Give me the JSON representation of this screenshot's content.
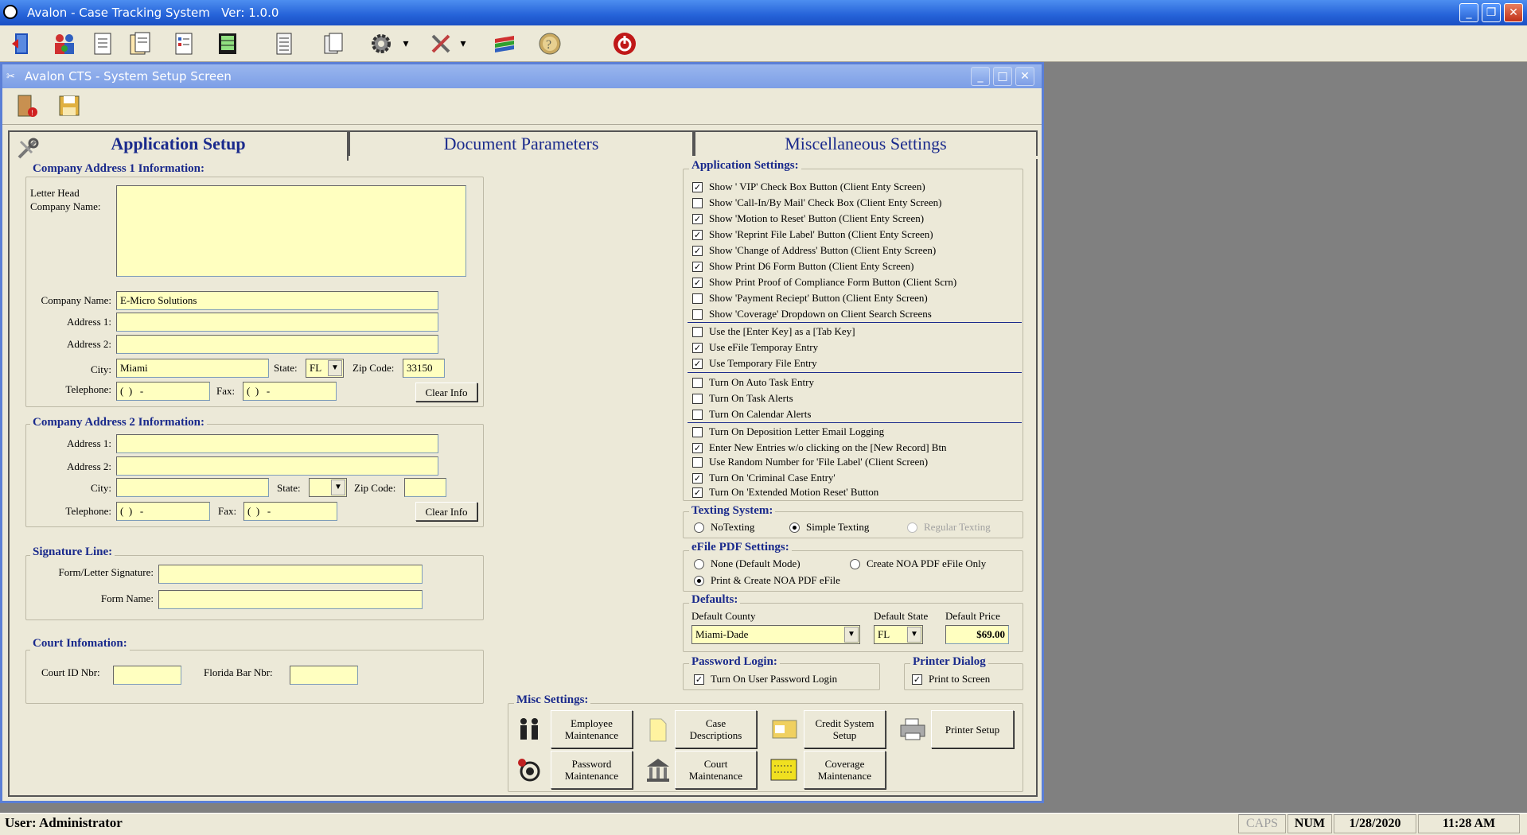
{
  "app": {
    "title": "Avalon - Case Tracking System   Ver: 1.0.0"
  },
  "toolbar_icons": [
    "exit-door-icon",
    "people-icon",
    "document-icon",
    "documents-icon",
    "checklist-icon",
    "ledger-icon",
    "scroll-icon",
    "pages-icon",
    "gear-icon",
    "tools-icon",
    "layers-icon",
    "help-icon",
    "power-icon"
  ],
  "window": {
    "title": "Avalon CTS - System Setup Screen"
  },
  "tabs": [
    {
      "label": "Application Setup",
      "active": true
    },
    {
      "label": "Document Parameters",
      "active": false
    },
    {
      "label": "Miscellaneous Settings",
      "active": false
    }
  ],
  "addr1": {
    "legend": "Company Address 1 Information:",
    "letterhead_label": "Letter Head Company Name:",
    "letterhead_value": "",
    "company_label": "Company Name:",
    "company_value": "E-Micro Solutions",
    "address1_label": "Address 1:",
    "address1_value": "",
    "address2_label": "Address 2:",
    "address2_value": "",
    "city_label": "City:",
    "city_value": "Miami",
    "state_label": "State:",
    "state_value": "FL",
    "zip_label": "Zip Code:",
    "zip_value": "33150",
    "tel_label": "Telephone:",
    "tel_value": "(  )   -",
    "fax_label": "Fax:",
    "fax_value": "(  )   -",
    "clear_label": "Clear Info"
  },
  "addr2": {
    "legend": "Company Address 2 Information:",
    "address1_label": "Address 1:",
    "address1_value": "",
    "address2_label": "Address 2:",
    "address2_value": "",
    "city_label": "City:",
    "city_value": "",
    "state_label": "State:",
    "state_value": "",
    "zip_label": "Zip Code:",
    "zip_value": "",
    "tel_label": "Telephone:",
    "tel_value": "(  )   -",
    "fax_label": "Fax:",
    "fax_value": "(  )   -",
    "clear_label": "Clear Info"
  },
  "signature": {
    "legend": "Signature Line:",
    "sig_label": "Form/Letter Signature:",
    "sig_value": "",
    "form_label": "Form Name:",
    "form_value": ""
  },
  "court": {
    "legend": "Court Infomation:",
    "court_label": "Court ID Nbr:",
    "court_value": "",
    "bar_label": "Florida Bar Nbr:",
    "bar_value": ""
  },
  "app_settings": {
    "legend": "Application Settings:",
    "group1": [
      {
        "label": "Show ' VIP' Check Box Button  (Client Enty Screen)",
        "checked": true
      },
      {
        "label": "Show 'Call-In/By Mail' Check Box  (Client Enty Screen)",
        "checked": false
      },
      {
        "label": "Show 'Motion to Reset' Button  (Client Enty Screen)",
        "checked": true
      },
      {
        "label": "Show 'Reprint File Label' Button  (Client Enty Screen)",
        "checked": true
      },
      {
        "label": "Show 'Change of Address' Button  (Client Enty Screen)",
        "checked": true
      },
      {
        "label": "Show Print D6 Form Button  (Client Enty Screen)",
        "checked": true
      },
      {
        "label": "Show Print Proof of Compliance Form Button  (Client Scrn)",
        "checked": true
      },
      {
        "label": "Show 'Payment Reciept' Button  (Client Enty Screen)",
        "checked": false
      },
      {
        "label": "Show 'Coverage' Dropdown on Client Search Screens",
        "checked": false
      }
    ],
    "group2": [
      {
        "label": "Use the [Enter Key] as a [Tab Key]",
        "checked": false
      },
      {
        "label": "Use eFile Temporay Entry",
        "checked": true
      },
      {
        "label": "Use Temporary File Entry",
        "checked": true
      }
    ],
    "group3": [
      {
        "label": "Turn On Auto Task Entry",
        "checked": false
      },
      {
        "label": "Turn On Task Alerts",
        "checked": false
      },
      {
        "label": "Turn On Calendar Alerts",
        "checked": false
      }
    ],
    "group4": [
      {
        "label": "Turn On Deposition Letter Email Logging",
        "checked": false
      },
      {
        "label": "Enter New Entries w/o clicking on the [New Record] Btn",
        "checked": true
      },
      {
        "label": "Use Random Number for 'File Label'  (Client Screen)",
        "checked": false
      },
      {
        "label": "Turn On 'Criminal Case Entry'",
        "checked": true
      },
      {
        "label": "Turn On 'Extended Motion Reset' Button",
        "checked": true
      }
    ]
  },
  "texting": {
    "legend": "Texting System:",
    "options": [
      {
        "label": "NoTexting",
        "selected": false,
        "disabled": false
      },
      {
        "label": "Simple Texting",
        "selected": true,
        "disabled": false
      },
      {
        "label": "Regular Texting",
        "selected": false,
        "disabled": true
      }
    ]
  },
  "efile": {
    "legend": "eFile PDF Settings:",
    "options": [
      {
        "label": "None (Default Mode)",
        "selected": false
      },
      {
        "label": "Create NOA PDF eFile Only",
        "selected": false
      },
      {
        "label": "Print & Create NOA PDF eFile",
        "selected": true
      }
    ]
  },
  "defaults": {
    "legend": "Defaults:",
    "county_label": "Default County",
    "county_value": "Miami-Dade",
    "state_label": "Default State",
    "state_value": "FL",
    "price_label": "Default Price",
    "price_value": "$69.00"
  },
  "password": {
    "legend": "Password Login:",
    "label": "Turn On User Password Login",
    "checked": true
  },
  "printer": {
    "legend": "Printer Dialog",
    "label": "Print to Screen",
    "checked": true
  },
  "misc": {
    "legend": "Misc Settings:",
    "employee": [
      "Employee",
      "Maintenance"
    ],
    "case": [
      "Case",
      "Descriptions"
    ],
    "credit": [
      "Credit System",
      "Setup"
    ],
    "printer_setup": "Printer Setup",
    "password": [
      "Password",
      "Maintenance"
    ],
    "court": [
      "Court",
      "Maintenance"
    ],
    "coverage": [
      "Coverage",
      "Maintenance"
    ]
  },
  "status": {
    "user": "User: Administrator",
    "caps": "CAPS",
    "num": "NUM",
    "date": "1/28/2020",
    "time": "11:28 AM"
  },
  "colors": {
    "field_bg": "#ffffc0",
    "label_blue": "#1a2a8c",
    "face": "#ece9d8"
  }
}
